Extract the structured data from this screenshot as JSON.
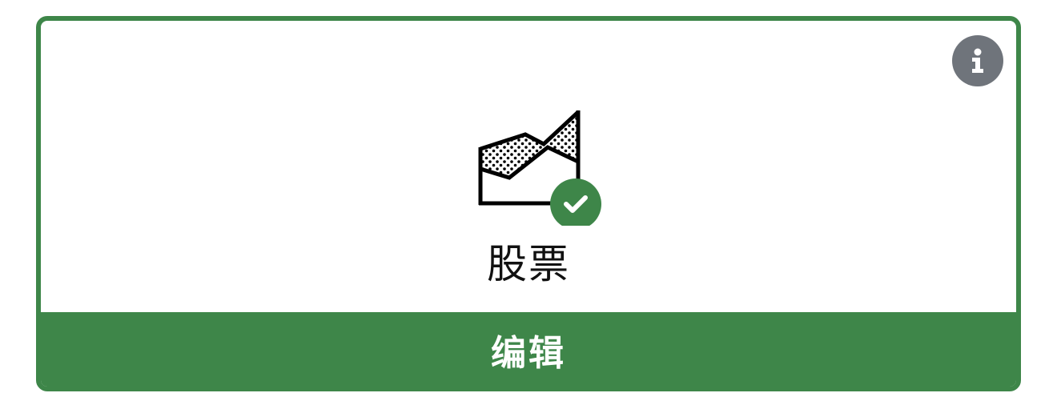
{
  "card": {
    "label": "股票",
    "edit_label": "编辑",
    "selected": true,
    "icon": "stock-area-chart-icon",
    "info_icon": "info-icon",
    "check_icon": "check-circle-icon"
  },
  "colors": {
    "accent": "#3e8649",
    "info_badge": "#6f747b",
    "text": "#111111"
  }
}
